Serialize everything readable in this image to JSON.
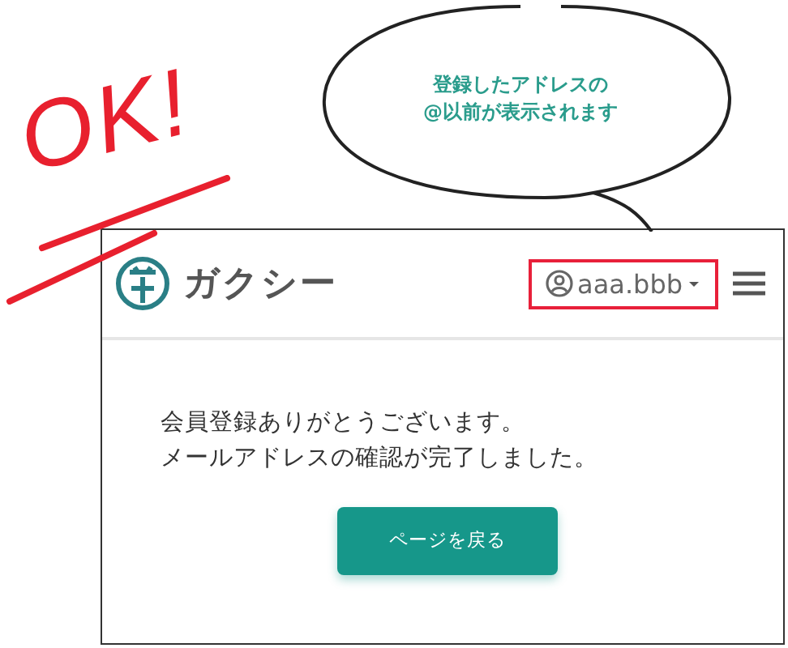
{
  "annotation": {
    "stamp": "OK!",
    "bubble_lines": [
      "登録したアドレスの",
      "@以前が表示されます"
    ]
  },
  "header": {
    "logo_text": "ガクシー",
    "user": {
      "name": "aaa.bbb",
      "highlighted": true
    }
  },
  "message": [
    "会員登録ありがとうございます。",
    "メールアドレスの確認が完了しました。"
  ],
  "button": "ページを戻る"
}
